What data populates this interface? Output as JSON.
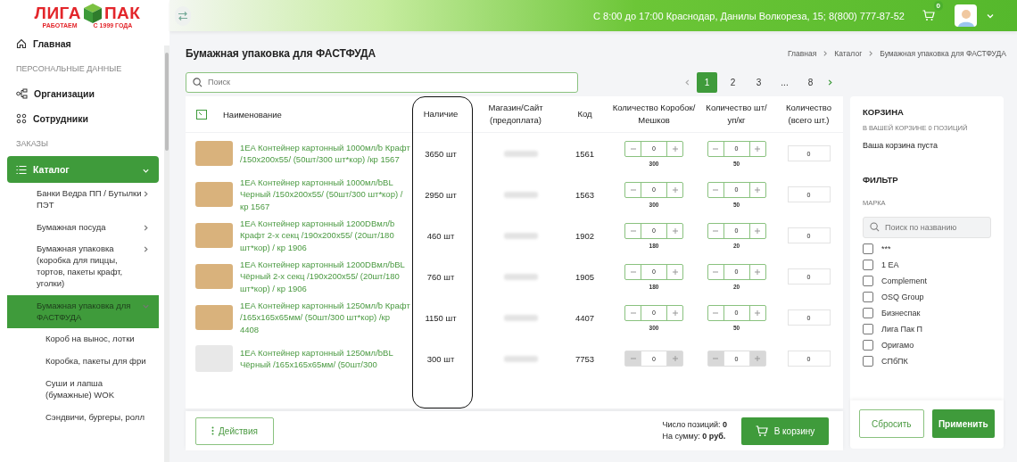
{
  "logo": {
    "left": "ЛИГА",
    "right": "ПАК",
    "tagline_left": "РАБОТАЕМ",
    "tagline_right": "С 1999 ГОДА"
  },
  "topbar": {
    "contact": "С 8:00 до 17:00 Краснодар, Данилы Волкореза, 15; 8(800) 777-87-52",
    "cart_count": "0"
  },
  "sidebar": {
    "items": [
      {
        "kind": "link",
        "label": "Главная",
        "selected": false
      },
      {
        "kind": "section",
        "label": "ПЕРСОНАЛЬНЫЕ ДАННЫЕ"
      },
      {
        "kind": "link",
        "label": "Организации",
        "selected": false
      },
      {
        "kind": "link",
        "label": "Сотрудники",
        "selected": false
      },
      {
        "kind": "section",
        "label": "ЗАКАЗЫ"
      },
      {
        "kind": "link",
        "label": "Каталог",
        "selected": true,
        "expanded": true,
        "children": [
          {
            "label": "Банки Ведра ПП / Бутылки ПЭТ",
            "selected": false,
            "expanded": false
          },
          {
            "label": "Бумажная посуда",
            "selected": false,
            "expanded": false
          },
          {
            "label": "Бумажная упаковка (коробка для пиццы, тортов, пакеты крафт, уголки)",
            "selected": false,
            "expanded": false
          },
          {
            "label": "Бумажная упаковка для ФАСТФУДА",
            "selected": true,
            "expanded": true,
            "children": [
              {
                "label": "Короб на вынос, лотки",
                "selected": false
              },
              {
                "label": "Коробка, пакеты для фри",
                "selected": false
              },
              {
                "label": "Суши и лапша (бумажные) WOK",
                "selected": false
              },
              {
                "label": "Сэндвичи, бургеры, ролл",
                "selected": false
              }
            ]
          }
        ]
      }
    ]
  },
  "page": {
    "title": "Бумажная упаковка для ФАСТФУДА",
    "breadcrumbs": [
      "Главная",
      "Каталог",
      "Бумажная упаковка для ФАСТФУДА"
    ],
    "search": {
      "placeholder": "Поиск"
    },
    "pagination": [
      {
        "label": "1",
        "selected": true
      },
      {
        "label": "2",
        "selected": false
      },
      {
        "label": "3",
        "selected": false
      },
      {
        "label": "...",
        "selected": false
      },
      {
        "label": "8",
        "selected": false
      }
    ]
  },
  "table": {
    "columns": [
      "Наименование",
      "Наличие",
      "Магазин/Сайт (предоплата)",
      "Код",
      "Количество Коробок/Мешков",
      "Количество шт/уп/кг",
      "Количество (всего шт.)"
    ],
    "rows": [
      {
        "name": "1EA Контейнер картонный 1000мл/b Крафт /150х200х55/ (50шт/300 шт*кор) /кр 1567",
        "kind": "photo",
        "stock": "3650 шт",
        "code": "1561",
        "boxes": "0",
        "boxes_step": "300",
        "units": "0",
        "units_step": "50",
        "total": "0",
        "disabled": false
      },
      {
        "name": "1EA Контейнер картонный 1000мл/bBL Черный /150х200х55/ (50шт/300 шт*кор) /кр 1567",
        "kind": "photo",
        "stock": "2950 шт",
        "code": "1563",
        "boxes": "0",
        "boxes_step": "300",
        "units": "0",
        "units_step": "50",
        "total": "0",
        "disabled": false
      },
      {
        "name": "1EA Контейнер картонный 1200DBмл/b Крафт 2-х секц /190х200х55/ (20шт/180 шт*кор) / кр 1906",
        "kind": "photo",
        "stock": "460 шт",
        "code": "1902",
        "boxes": "0",
        "boxes_step": "180",
        "units": "0",
        "units_step": "20",
        "total": "0",
        "disabled": false
      },
      {
        "name": "1EA Контейнер картонный 1200DBмл/bBL Чёрный 2-х секц /190х200х55/ (20шт/180 шт*кор) / кр 1906",
        "kind": "photo",
        "stock": "760 шт",
        "code": "1905",
        "boxes": "0",
        "boxes_step": "180",
        "units": "0",
        "units_step": "20",
        "total": "0",
        "disabled": false
      },
      {
        "name": "1EA Контейнер картонный 1250мл/b Крафт /165х165х65мм/ (50шт/300 шт*кор) /кр 4408",
        "kind": "photo",
        "stock": "1150 шт",
        "code": "4407",
        "boxes": "0",
        "boxes_step": "300",
        "units": "0",
        "units_step": "50",
        "total": "0",
        "disabled": false
      },
      {
        "name": "1EA Контейнер картонный 1250мл/bBL Чёрный /165х165х65мм/ (50шт/300",
        "kind": "placeholder",
        "stock": "300 шт",
        "code": "7753",
        "boxes": "0",
        "units": "0",
        "total": "0",
        "disabled": true
      }
    ]
  },
  "footer": {
    "actions": "Действия",
    "count": "Число позиций: **0**",
    "sum": "На сумму: **0 руб.**",
    "cart_button": "В корзину"
  },
  "panel": {
    "cart_title": "КОРЗИНА",
    "cart_subtitle": "В ВАШЕЙ КОРЗИНЕ 0 ПОЗИЦИЙ",
    "cart_empty": "Ваша корзина пуста",
    "filter_title": "ФИЛЬТР",
    "brand_label": "МАРКА",
    "brand_search": {
      "placeholder": "Поиск по названию"
    },
    "brands": [
      {
        "label": "***",
        "checked": false
      },
      {
        "label": "1 EA",
        "checked": false
      },
      {
        "label": "Complement",
        "checked": false
      },
      {
        "label": "OSQ Group",
        "checked": false
      },
      {
        "label": "Бизнеспак",
        "checked": false
      },
      {
        "label": "Лига Пак П",
        "checked": false
      },
      {
        "label": "Оригамо",
        "checked": false
      },
      {
        "label": "СПбПК",
        "checked": false
      }
    ],
    "reset": "Сбросить",
    "apply": "Применить"
  }
}
